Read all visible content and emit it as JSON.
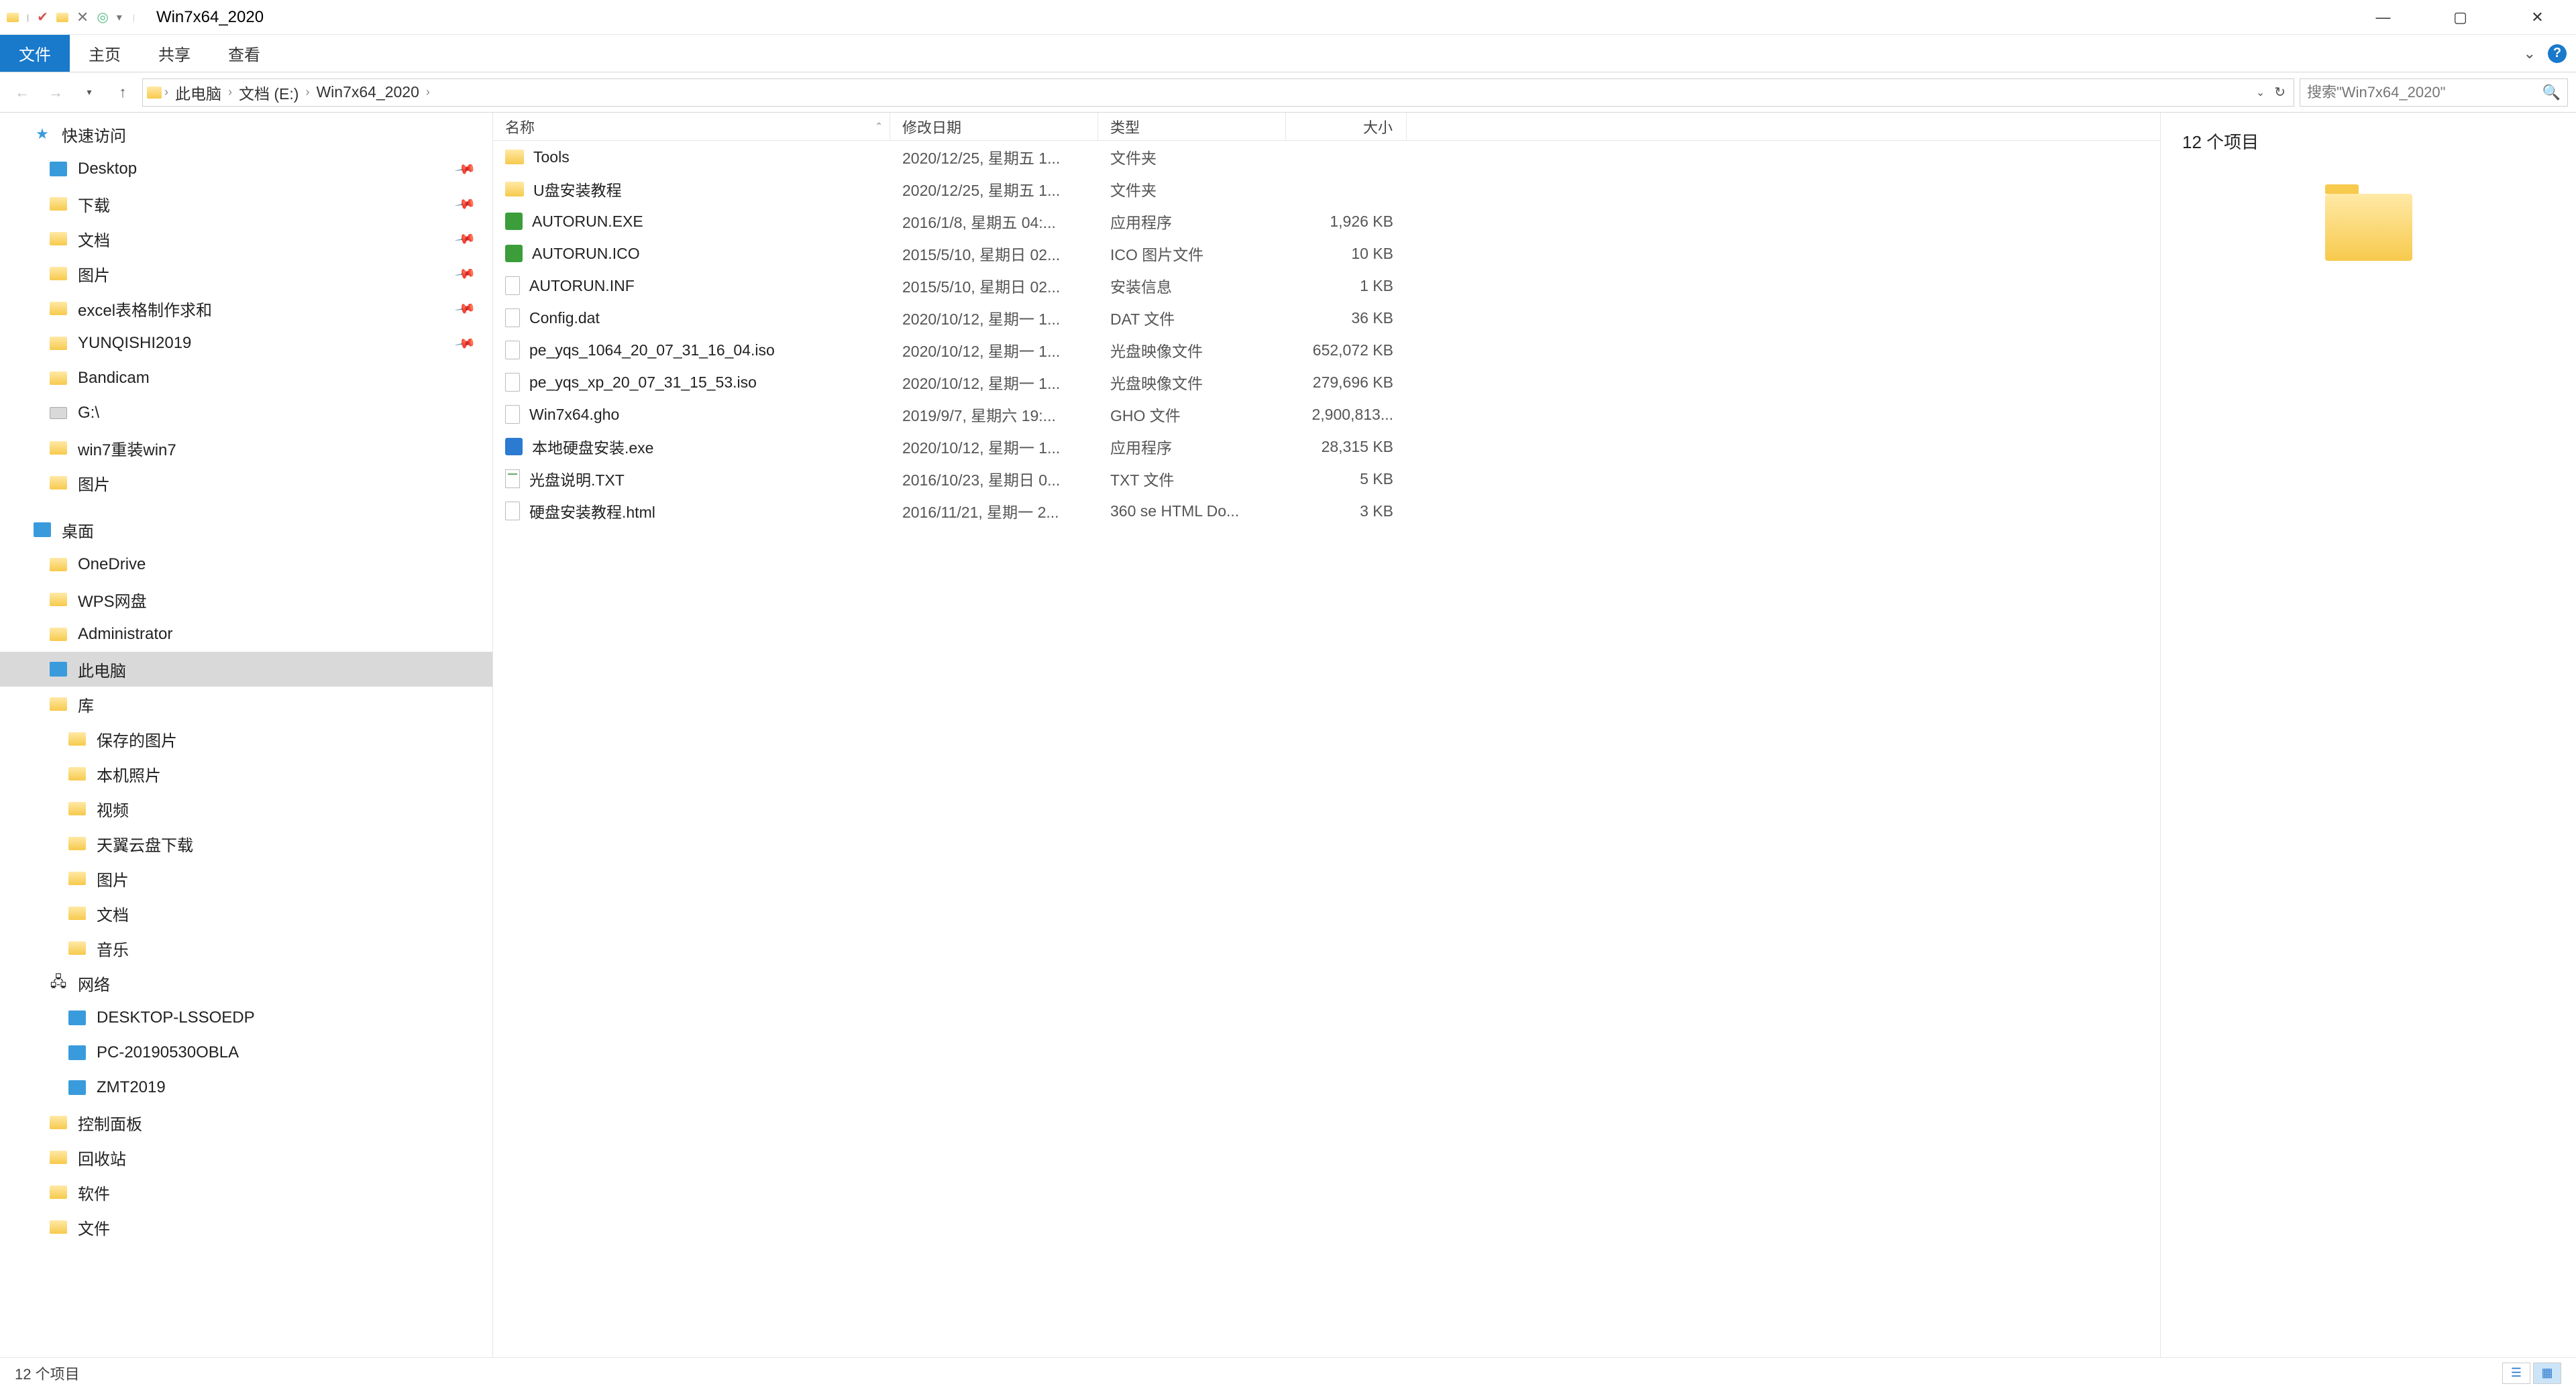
{
  "title": "Win7x64_2020",
  "ribbon_tabs": {
    "file": "文件",
    "home": "主页",
    "share": "共享",
    "view": "查看"
  },
  "breadcrumbs": [
    "此电脑",
    "文档 (E:)",
    "Win7x64_2020"
  ],
  "search_placeholder": "搜索\"Win7x64_2020\"",
  "columns": {
    "name": "名称",
    "date": "修改日期",
    "type": "类型",
    "size": "大小"
  },
  "sidebar": {
    "quick_access": "快速访问",
    "quick_items": [
      {
        "label": "Desktop",
        "icon": "pc",
        "pinned": true
      },
      {
        "label": "下载",
        "icon": "folder",
        "pinned": true
      },
      {
        "label": "文档",
        "icon": "folder",
        "pinned": true
      },
      {
        "label": "图片",
        "icon": "folder",
        "pinned": true
      },
      {
        "label": "excel表格制作求和",
        "icon": "folder",
        "pinned": true
      },
      {
        "label": "YUNQISHI2019",
        "icon": "folder",
        "pinned": true
      },
      {
        "label": "Bandicam",
        "icon": "folder",
        "pinned": false
      },
      {
        "label": "G:\\",
        "icon": "drive",
        "pinned": false
      },
      {
        "label": "win7重装win7",
        "icon": "folder",
        "pinned": false
      },
      {
        "label": "图片",
        "icon": "folder",
        "pinned": false
      }
    ],
    "desktop": "桌面",
    "desktop_items": [
      {
        "label": "OneDrive",
        "icon": "cloud"
      },
      {
        "label": "WPS网盘",
        "icon": "cloud"
      },
      {
        "label": "Administrator",
        "icon": "user"
      },
      {
        "label": "此电脑",
        "icon": "pc",
        "selected": true
      },
      {
        "label": "库",
        "icon": "folder"
      }
    ],
    "lib_items": [
      {
        "label": "保存的图片"
      },
      {
        "label": "本机照片"
      },
      {
        "label": "视频"
      },
      {
        "label": "天翼云盘下载"
      },
      {
        "label": "图片"
      },
      {
        "label": "文档"
      },
      {
        "label": "音乐"
      }
    ],
    "network": "网络",
    "network_items": [
      {
        "label": "DESKTOP-LSSOEDP"
      },
      {
        "label": "PC-20190530OBLA"
      },
      {
        "label": "ZMT2019"
      }
    ],
    "bottom_items": [
      {
        "label": "控制面板"
      },
      {
        "label": "回收站"
      },
      {
        "label": "软件"
      },
      {
        "label": "文件"
      }
    ]
  },
  "files": [
    {
      "name": "Tools",
      "date": "2020/12/25, 星期五 1...",
      "type": "文件夹",
      "size": "",
      "icon": "fold"
    },
    {
      "name": "U盘安装教程",
      "date": "2020/12/25, 星期五 1...",
      "type": "文件夹",
      "size": "",
      "icon": "fold"
    },
    {
      "name": "AUTORUN.EXE",
      "date": "2016/1/8, 星期五 04:...",
      "type": "应用程序",
      "size": "1,926 KB",
      "icon": "exe"
    },
    {
      "name": "AUTORUN.ICO",
      "date": "2015/5/10, 星期日 02...",
      "type": "ICO 图片文件",
      "size": "10 KB",
      "icon": "ico"
    },
    {
      "name": "AUTORUN.INF",
      "date": "2015/5/10, 星期日 02...",
      "type": "安装信息",
      "size": "1 KB",
      "icon": "file"
    },
    {
      "name": "Config.dat",
      "date": "2020/10/12, 星期一 1...",
      "type": "DAT 文件",
      "size": "36 KB",
      "icon": "file"
    },
    {
      "name": "pe_yqs_1064_20_07_31_16_04.iso",
      "date": "2020/10/12, 星期一 1...",
      "type": "光盘映像文件",
      "size": "652,072 KB",
      "icon": "file"
    },
    {
      "name": "pe_yqs_xp_20_07_31_15_53.iso",
      "date": "2020/10/12, 星期一 1...",
      "type": "光盘映像文件",
      "size": "279,696 KB",
      "icon": "file"
    },
    {
      "name": "Win7x64.gho",
      "date": "2019/9/7, 星期六 19:...",
      "type": "GHO 文件",
      "size": "2,900,813...",
      "icon": "file"
    },
    {
      "name": "本地硬盘安装.exe",
      "date": "2020/10/12, 星期一 1...",
      "type": "应用程序",
      "size": "28,315 KB",
      "icon": "app"
    },
    {
      "name": "光盘说明.TXT",
      "date": "2016/10/23, 星期日 0...",
      "type": "TXT 文件",
      "size": "5 KB",
      "icon": "txt"
    },
    {
      "name": "硬盘安装教程.html",
      "date": "2016/11/21, 星期一 2...",
      "type": "360 se HTML Do...",
      "size": "3 KB",
      "icon": "file"
    }
  ],
  "preview_title": "12 个项目",
  "status_text": "12 个项目"
}
